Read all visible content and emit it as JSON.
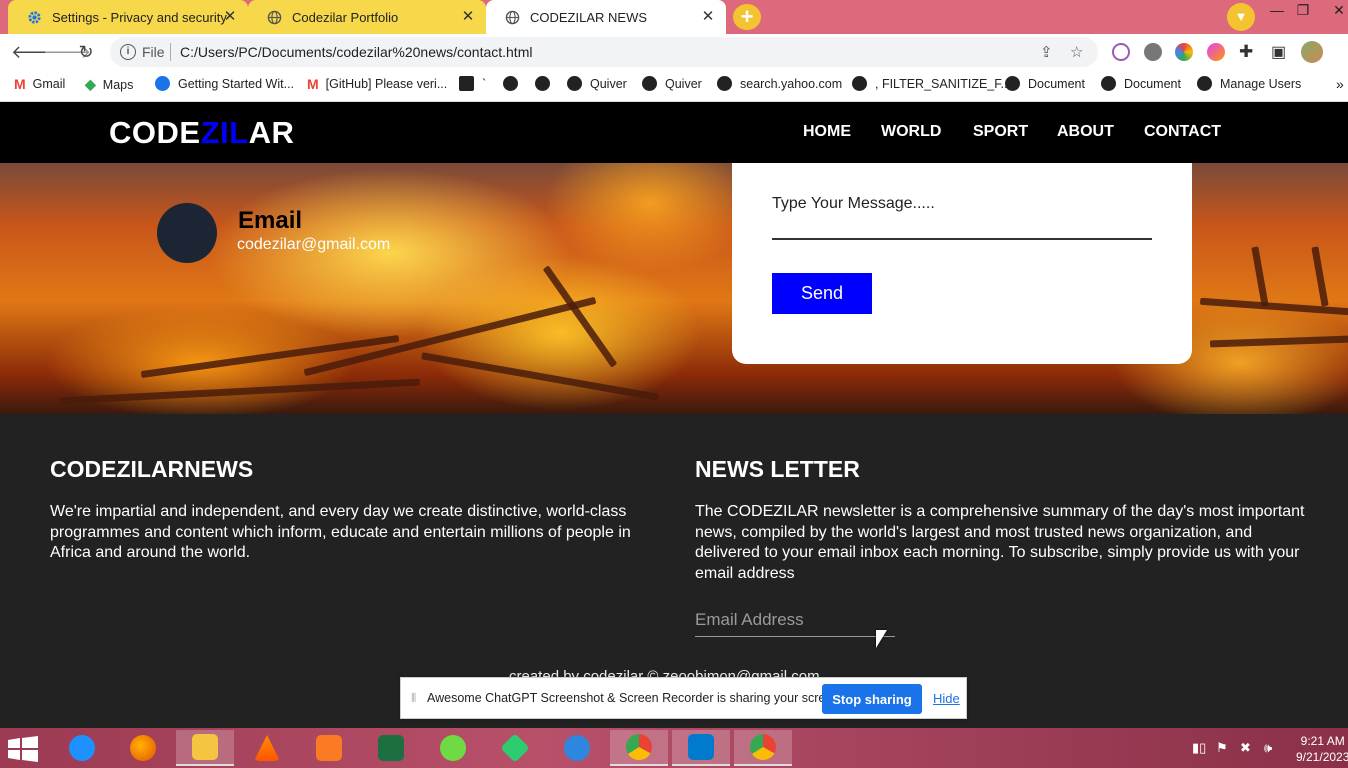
{
  "browser": {
    "tabs": [
      {
        "title": "Settings - Privacy and security",
        "icon": "gear-icon"
      },
      {
        "title": "Codezilar Portfolio",
        "icon": "globe-icon"
      },
      {
        "title": "CODEZILAR NEWS",
        "icon": "globe-icon",
        "active": true
      }
    ],
    "new_tab": "+",
    "address": {
      "scheme": "File",
      "url": "C:/Users/PC/Documents/codezilar%20news/contact.html"
    },
    "bookmarks": [
      {
        "label": "Gmail",
        "icon": "gmail-icon"
      },
      {
        "label": "Maps",
        "icon": "maps-icon"
      },
      {
        "label": "Getting Started Wit...",
        "icon": "s-icon"
      },
      {
        "label": "[GitHub] Please veri...",
        "icon": "gmail-icon"
      },
      {
        "label": "`",
        "icon": "bookmark-icon"
      },
      {
        "label": "",
        "icon": "globe-icon"
      },
      {
        "label": "",
        "icon": "globe-icon"
      },
      {
        "label": "Quiver",
        "icon": "globe-icon"
      },
      {
        "label": "Quiver",
        "icon": "globe-icon"
      },
      {
        "label": "search.yahoo.com",
        "icon": "globe-icon"
      },
      {
        "label": ", FILTER_SANITIZE_F...",
        "icon": "globe-icon"
      },
      {
        "label": "Document",
        "icon": "globe-icon"
      },
      {
        "label": "Document",
        "icon": "globe-icon"
      },
      {
        "label": "Manage Users",
        "icon": "globe-icon"
      }
    ],
    "bookmarks_more": "»"
  },
  "site": {
    "logo": {
      "part1": "CODE",
      "part2": "ZIL",
      "part3": "AR"
    },
    "nav": [
      "HOME",
      "WORLD",
      "SPORT",
      "ABOUT",
      "CONTACT"
    ],
    "contact": {
      "email_label": "Email",
      "email_value": "codezilar@gmail.com",
      "message_placeholder": "Type Your Message.....",
      "send_label": "Send"
    },
    "footer": {
      "left_title": "CODEZILARNEWS",
      "left_text": "We're impartial and independent, and every day we create distinctive, world-class programmes and content which inform, educate and entertain millions of people in Africa and around the world.",
      "right_title": "NEWS LETTER",
      "right_text": "The CODEZILAR newsletter is a comprehensive summary of the day's most important news, compiled by the world's largest and most trusted news organization, and delivered to your email inbox each morning. To subscribe, simply provide us with your email address",
      "email_placeholder": "Email Address",
      "credit": "created by codezilar © zeoobimon@gmail.com"
    },
    "colors": {
      "accent_blue": "#0000ff",
      "header_bg": "#000000",
      "footer_bg": "#222222"
    }
  },
  "sharebar": {
    "text": "Awesome ChatGPT Screenshot & Screen Recorder is sharing your screen.",
    "stop_label": "Stop sharing",
    "hide_label": "Hide"
  },
  "taskbar": {
    "apps": [
      "internet-explorer-icon",
      "firefox-icon",
      "file-explorer-icon",
      "vlc-icon",
      "xampp-icon",
      "excel-icon",
      "upwork-icon",
      "app-icon",
      "sage-icon",
      "chrome-icon",
      "vscode-icon",
      "chrome-profile-icon"
    ],
    "time": "9:21 AM",
    "date": "9/21/2023"
  }
}
